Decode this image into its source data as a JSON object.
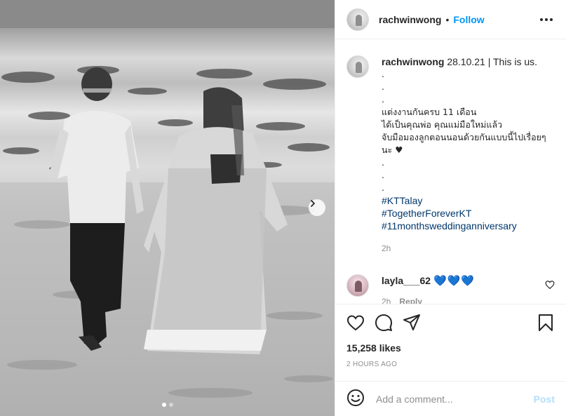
{
  "post": {
    "author": "rachwinwong",
    "header_separator": "•",
    "follow_label": "Follow",
    "caption": {
      "username": "rachwinwong",
      "lines": [
        "28.10.21 | This is us.",
        ".",
        ".",
        ".",
        "แต่งงานกันครบ 11 เดือน",
        "ได้เป็นคุณพ่อ คุณแม่มือใหม่แล้ว",
        "จับมือมองลูกตอนนอนด้วยกันแบบนี้ไปเรื่อยๆ",
        "นะ ♥",
        ".",
        ".",
        "."
      ],
      "hashtags": [
        "#KTTalay",
        "#TogetherForeverKT",
        "#11monthsweddinganniversary"
      ],
      "time": "2h"
    },
    "comment": {
      "username": "layla___62",
      "text": "💙💙💙",
      "time": "2h",
      "reply_label": "Reply"
    },
    "likes": "15,258 likes",
    "timestamp": "2 HOURS AGO",
    "add_comment": {
      "placeholder": "Add a comment...",
      "post_label": "Post"
    },
    "carousel": {
      "slide_count": 2,
      "active_index": 0
    },
    "icons": {
      "more": "more-icon",
      "like": "heart-icon",
      "comment": "comment-icon",
      "share": "share-icon",
      "save": "bookmark-icon",
      "emoji": "emoji-icon",
      "next": "chevron-right-icon"
    },
    "colors": {
      "accent": "#0095f6",
      "hashtag": "#00376b",
      "muted": "#8e8e8e",
      "post_disabled": "#b2dffc",
      "hearts": "#0d6fd8"
    }
  }
}
